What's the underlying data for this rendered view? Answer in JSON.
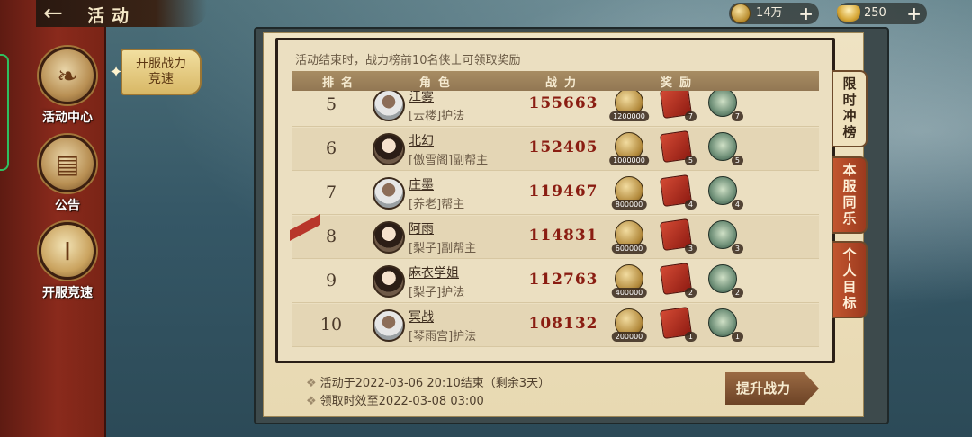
{
  "header": {
    "title": "活动",
    "resources": [
      {
        "icon": "copper-coin-icon",
        "value": "14万"
      },
      {
        "icon": "gold-ingot-icon",
        "value": "250"
      }
    ]
  },
  "left_nav": {
    "items": [
      {
        "label": "活动中心",
        "icon": "scroll-icon"
      },
      {
        "label": "公告",
        "icon": "notice-board-icon"
      },
      {
        "label": "开服竞速",
        "icon": "podium-icon"
      }
    ]
  },
  "subnav": {
    "line1": "开服战力",
    "line2": "竞速"
  },
  "panel": {
    "notice": "活动结束时，战力榜前10名侠士可领取奖励",
    "columns": [
      "排名",
      "角色",
      "战力",
      "奖励"
    ],
    "rows": [
      {
        "rank": "5",
        "name": "江雾",
        "guild": "[云楼]护法",
        "power": "155663",
        "rewards": [
          "1200000",
          "7",
          "7"
        ]
      },
      {
        "rank": "6",
        "name": "北幻",
        "guild": "[傲雪阁]副帮主",
        "power": "152405",
        "rewards": [
          "1000000",
          "5",
          "5"
        ]
      },
      {
        "rank": "7",
        "name": "庄墨",
        "guild": "[养老]帮主",
        "power": "119467",
        "rewards": [
          "800000",
          "4",
          "4"
        ]
      },
      {
        "rank": "8",
        "name": "阿雨",
        "guild": "[梨子]副帮主",
        "power": "114831",
        "rewards": [
          "600000",
          "3",
          "3"
        ]
      },
      {
        "rank": "9",
        "name": "麻衣学姐",
        "guild": "[梨子]护法",
        "power": "112763",
        "rewards": [
          "400000",
          "2",
          "2"
        ]
      },
      {
        "rank": "10",
        "name": "冥战",
        "guild": "[琴雨宫]护法",
        "power": "108132",
        "rewards": [
          "200000",
          "1",
          "1"
        ]
      }
    ],
    "footer": {
      "end_time": "活动于2022-03-06  20:10结束（剩余3天）",
      "claim_time": "领取时效至2022-03-08 03:00"
    },
    "boost_button": "提升战力"
  },
  "side_tabs": [
    {
      "label": "限时冲榜",
      "active": true
    },
    {
      "label": "本服同乐",
      "active": false
    },
    {
      "label": "个人目标",
      "active": false
    }
  ],
  "colors": {
    "rail_red": "#8a2a1c",
    "power_red": "#8a1d12",
    "parchment": "#ebdfc1"
  }
}
